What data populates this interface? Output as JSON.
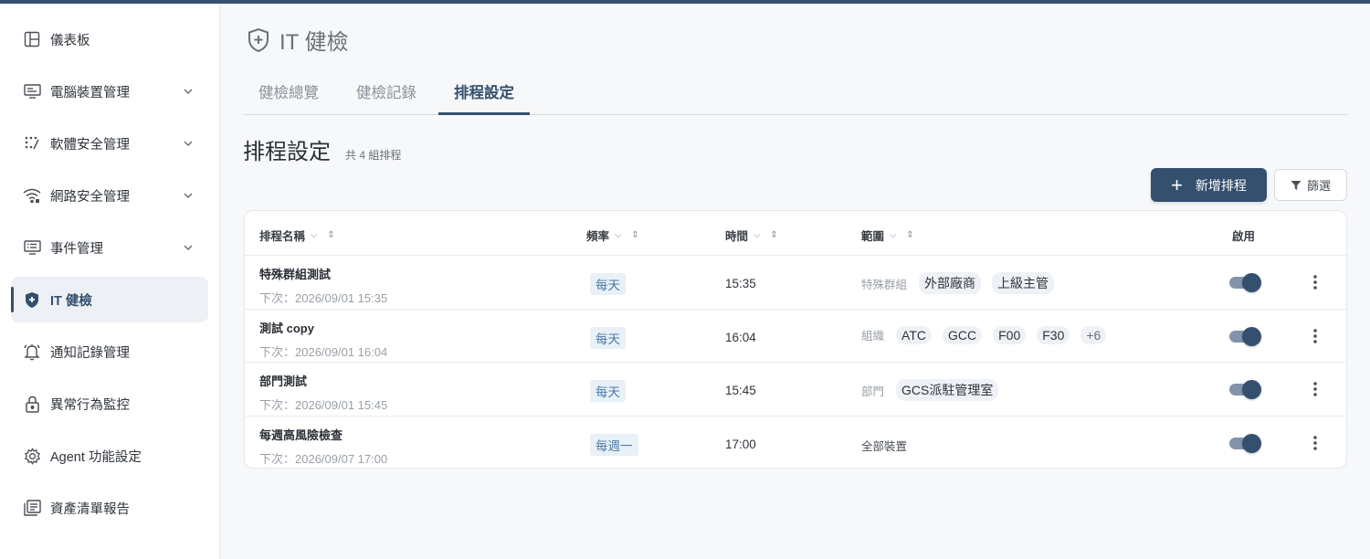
{
  "sidebar": {
    "items": [
      {
        "label": "儀表板",
        "icon": "layout-icon"
      },
      {
        "label": "電腦裝置管理",
        "icon": "monitor-icon"
      },
      {
        "label": "軟體安全管理",
        "icon": "dots-icon"
      },
      {
        "label": "網路安全管理",
        "icon": "wifi-icon"
      },
      {
        "label": "事件管理",
        "icon": "list-icon"
      },
      {
        "label": "IT 健檢",
        "icon": "shield-plus-icon"
      },
      {
        "label": "通知記錄管理",
        "icon": "bell-icon"
      },
      {
        "label": "異常行為監控",
        "icon": "lock-icon"
      },
      {
        "label": "Agent 功能設定",
        "icon": "gear-icon"
      },
      {
        "label": "資產清單報告",
        "icon": "report-icon"
      }
    ]
  },
  "page": {
    "title": "IT 健檢"
  },
  "tabs": [
    "健檢總覽",
    "健檢記錄",
    "排程設定"
  ],
  "section": {
    "title": "排程設定",
    "count": "共 4 組排程"
  },
  "buttons": {
    "add": "新增排程",
    "filter": "篩選"
  },
  "table": {
    "headers": {
      "name": "排程名稱",
      "freq": "頻率",
      "time": "時間",
      "scope": "範圍",
      "enabled": "啟用"
    },
    "rows": [
      {
        "name": "特殊群組測試",
        "next": "下次：2026/09/01 15:35",
        "freq": "每天",
        "time": "15:35",
        "scope_type": "特殊群組",
        "chips": [
          "外部廠商",
          "上級主管"
        ],
        "enabled": true
      },
      {
        "name": "測試 copy",
        "next": "下次：2026/09/01 16:04",
        "freq": "每天",
        "time": "16:04",
        "scope_type": "組織",
        "chips": [
          "ATC",
          "GCC",
          "F00",
          "F30",
          "+6"
        ],
        "enabled": true
      },
      {
        "name": "部門測試",
        "next": "下次：2026/09/01 15:45",
        "freq": "每天",
        "time": "15:45",
        "scope_type": "部門",
        "chips": [
          "GCS派駐管理室"
        ],
        "enabled": true
      },
      {
        "name": "每週高風險檢查",
        "next": "下次：2026/09/07 17:00",
        "freq": "每週一",
        "time": "17:00",
        "scope_type": "全部裝置",
        "chips": [],
        "enabled": true
      }
    ]
  },
  "colors": {
    "accent": "#34506e",
    "freq_bg": "#e8f0f8",
    "freq_text": "#4d7aa6"
  }
}
